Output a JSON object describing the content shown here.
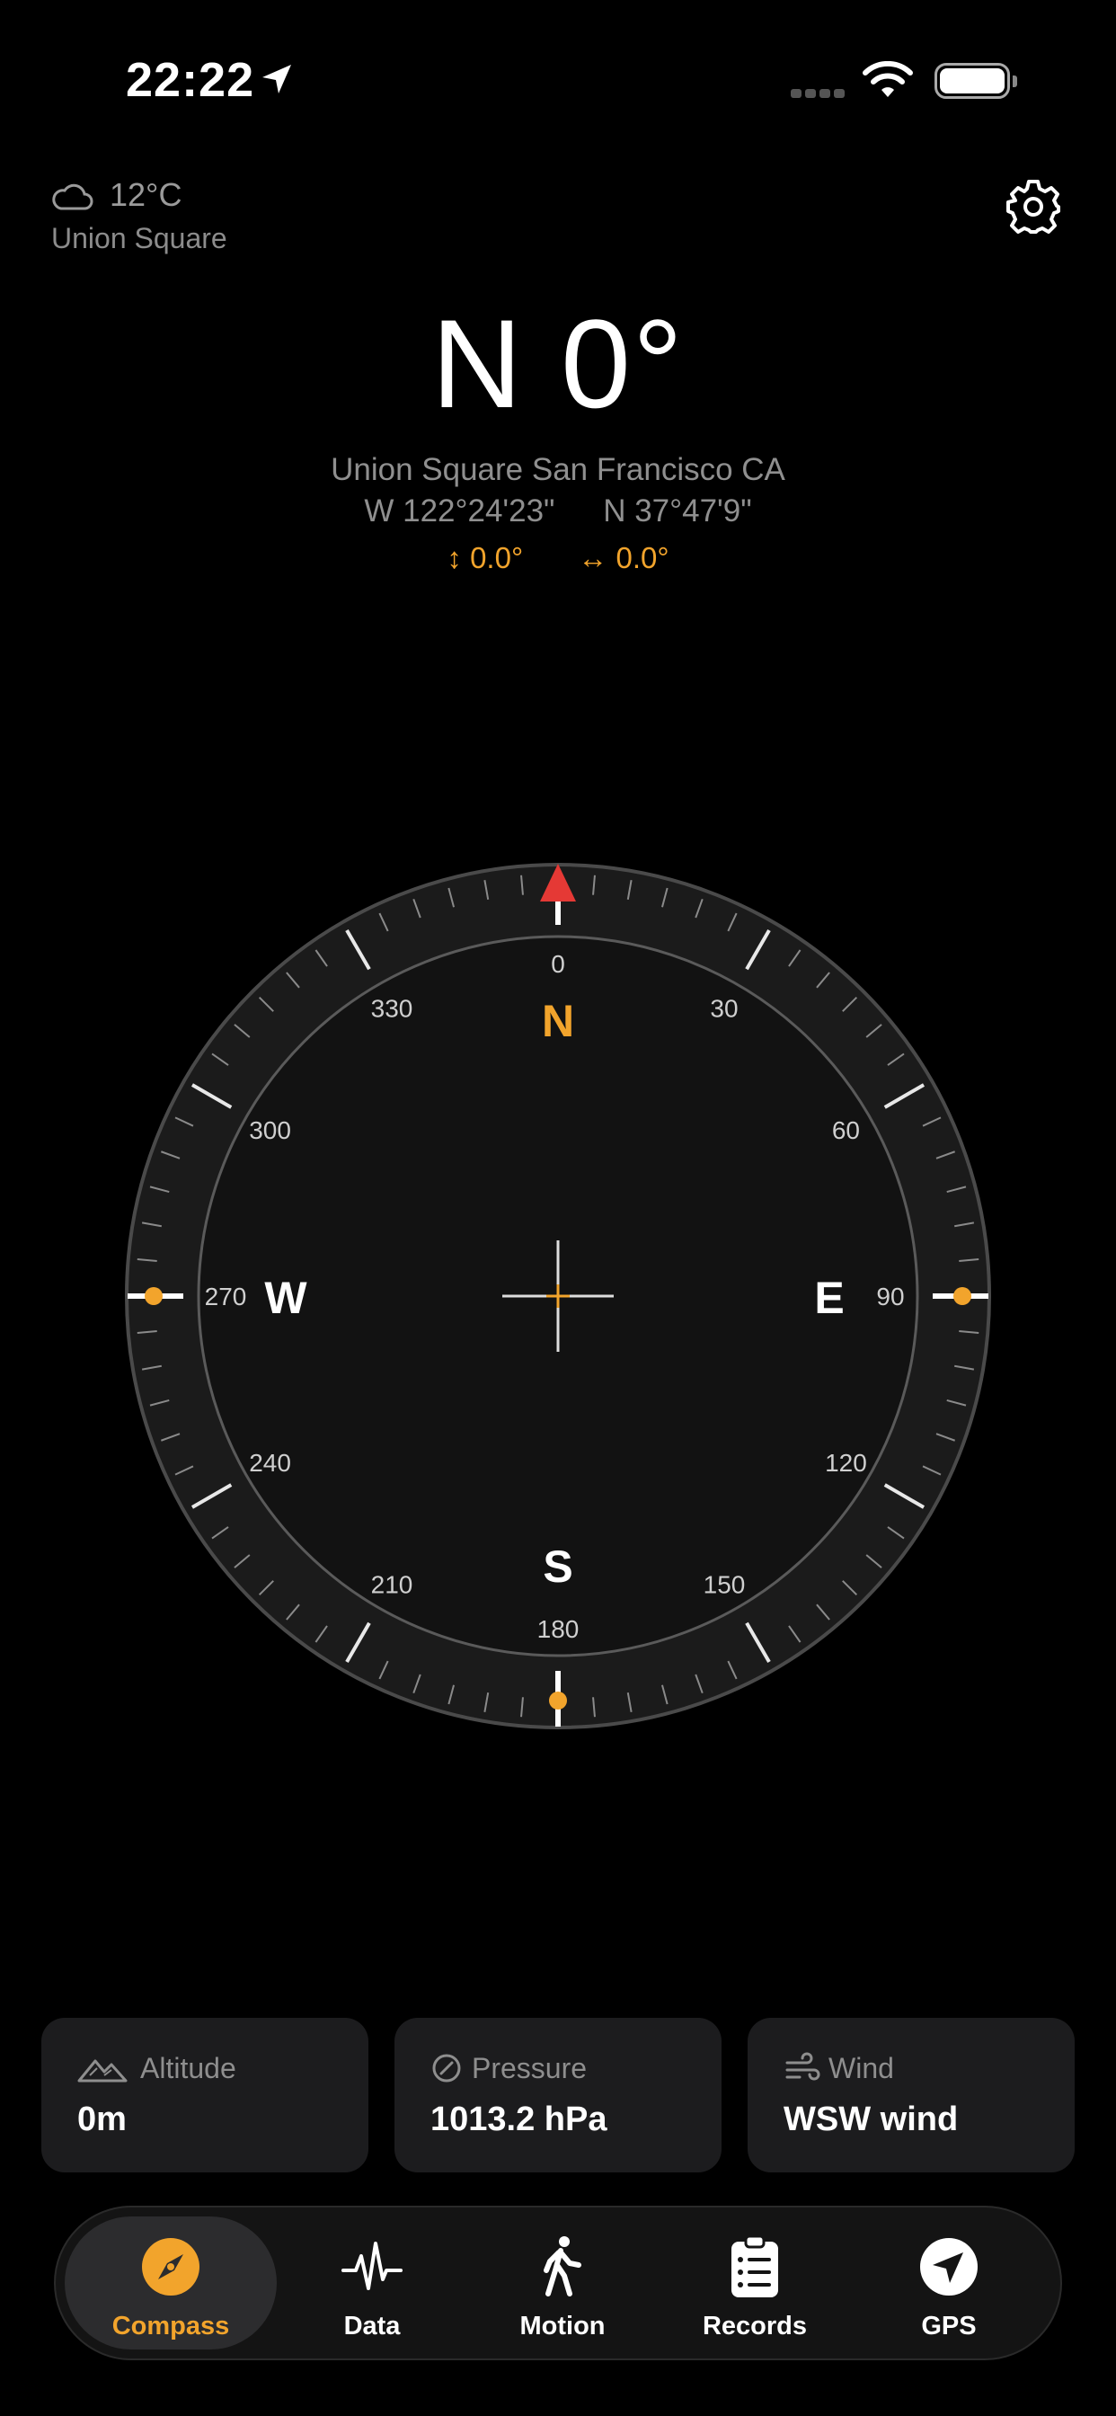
{
  "status": {
    "time": "22:22"
  },
  "weather": {
    "temp": "12°C",
    "place": "Union Square"
  },
  "heading": {
    "text": "N 0°"
  },
  "location": {
    "name": "Union Square San Francisco CA",
    "longitude": "W 122°24'23\"",
    "latitude": "N 37°47'9\"",
    "tilt_vertical": "↕ 0.0°",
    "tilt_horizontal": "↔ 0.0°"
  },
  "compass": {
    "heading_deg": 0,
    "cardinals": {
      "N": "N",
      "E": "E",
      "S": "S",
      "W": "W"
    },
    "degree_labels": [
      "0",
      "30",
      "60",
      "90",
      "120",
      "150",
      "180",
      "210",
      "240",
      "270",
      "300",
      "330"
    ],
    "accent": "#f2a42c",
    "needle": "#e53935"
  },
  "cards": [
    {
      "label": "Altitude",
      "value": "0m",
      "icon": "mountain-icon"
    },
    {
      "label": "Pressure",
      "value": "1013.2 hPa",
      "icon": "gauge-icon"
    },
    {
      "label": "Wind",
      "value": "WSW wind",
      "icon": "wind-icon"
    }
  ],
  "tabs": [
    {
      "label": "Compass",
      "icon": "compass-icon",
      "active": true
    },
    {
      "label": "Data",
      "icon": "pulse-icon",
      "active": false
    },
    {
      "label": "Motion",
      "icon": "walking-icon",
      "active": false
    },
    {
      "label": "Records",
      "icon": "clipboard-icon",
      "active": false
    },
    {
      "label": "GPS",
      "icon": "location-arrow-icon",
      "active": false
    }
  ]
}
